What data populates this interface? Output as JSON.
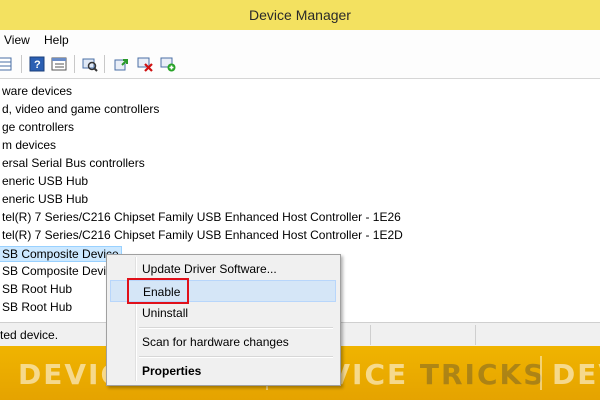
{
  "window": {
    "title": "Device Manager"
  },
  "menu": {
    "items": [
      "View",
      "Help"
    ]
  },
  "toolbar": {
    "icons": [
      "properties-grid-icon",
      "help-icon",
      "view-list-icon",
      "scan-hardware-icon",
      "update-driver-icon",
      "uninstall-icon",
      "enable-device-icon"
    ]
  },
  "tree": {
    "rows": [
      "ware devices",
      "d, video and game controllers",
      "ge controllers",
      "m devices",
      "ersal Serial Bus controllers",
      "eneric USB Hub",
      "eneric USB Hub",
      "tel(R) 7 Series/C216 Chipset Family USB Enhanced Host Controller - 1E26",
      "tel(R) 7 Series/C216 Chipset Family USB Enhanced Host Controller - 1E2D",
      "SB Composite Device",
      "SB Composite Device",
      "SB Root Hub",
      "SB Root Hub"
    ],
    "selected_index": 9
  },
  "status": {
    "text": "ted device."
  },
  "context_menu": {
    "update": "Update Driver Software...",
    "enable": "Enable",
    "uninstall": "Uninstall",
    "scan": "Scan for hardware changes",
    "properties": "Properties"
  },
  "banner": {
    "brand_left": "DEVICE",
    "brand_right": "TRICKS"
  },
  "colors": {
    "title_bar": "#f3e160",
    "highlight": "#e0101a",
    "banner": "#f0b400"
  }
}
